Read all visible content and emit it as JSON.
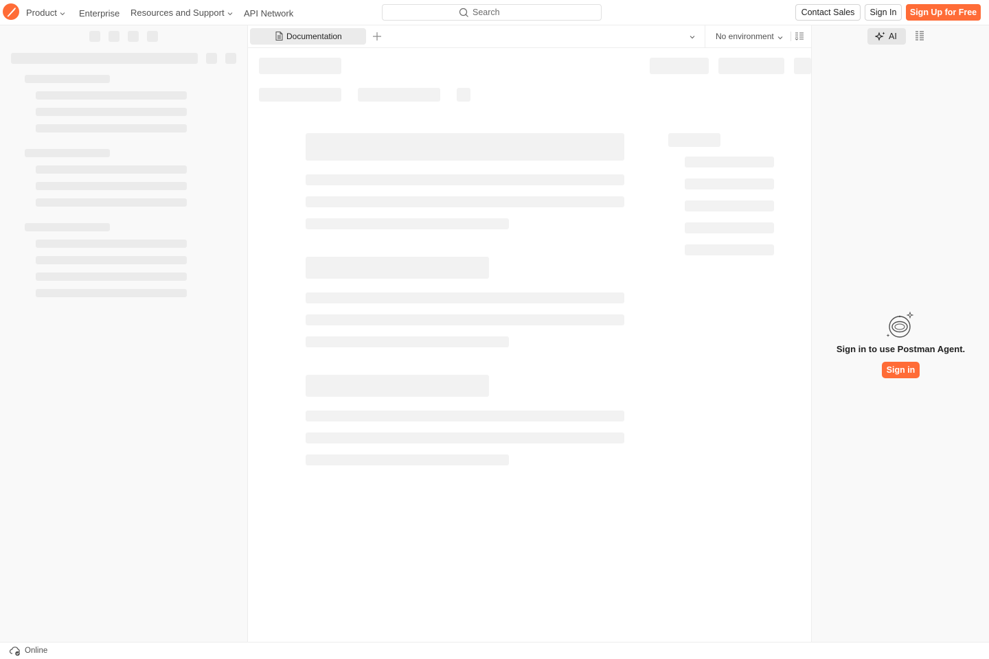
{
  "topbar": {
    "nav": {
      "product": "Product",
      "enterprise": "Enterprise",
      "resources": "Resources and Support",
      "api_network": "API Network"
    },
    "search_placeholder": "Search",
    "contact_sales": "Contact Sales",
    "sign_in": "Sign In",
    "sign_up": "Sign Up for Free"
  },
  "tabs": {
    "active_tab_label": "Documentation",
    "environment": "No environment"
  },
  "right_panel": {
    "ai_label": "AI",
    "agent_message": "Sign in to use Postman Agent.",
    "agent_signin": "Sign in"
  },
  "statusbar": {
    "status": "Online"
  },
  "colors": {
    "brand": "#ff6c37",
    "skeleton": "#ebebeb",
    "panel_bg": "#f9f9f9"
  },
  "icons": [
    "postman-logo-icon",
    "chevron-down-icon",
    "search-icon",
    "document-icon",
    "plus-icon",
    "environment-settings-icon",
    "ai-sparkle-icon",
    "context-panel-icon",
    "astronaut-icon",
    "online-cloud-icon"
  ]
}
